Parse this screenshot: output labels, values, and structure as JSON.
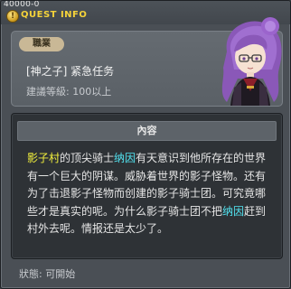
{
  "window": {
    "top_id": "40000-0",
    "title": "QUEST INFO"
  },
  "quest": {
    "job_label": "職業",
    "name": "[神之子] 紧急任务",
    "level": "建議等級: 100以上"
  },
  "description": {
    "header": "內容",
    "segments": [
      {
        "text": "影子村",
        "style": "yellow"
      },
      {
        "text": "的顶尖骑士",
        "style": "normal"
      },
      {
        "text": "纳因",
        "style": "cyan"
      },
      {
        "text": "有天意识到他所存在的世界有一个巨大的阴谋。威胁着世界的影子怪物。还有为了击退影子怪物而创建的影子骑士团。可究竟哪些才是真实的呢。为什么影子骑士团不把",
        "style": "normal"
      },
      {
        "text": "纳因",
        "style": "cyan"
      },
      {
        "text": "赶到村外去呢。情报还是太少了。",
        "style": "normal"
      }
    ]
  },
  "status": {
    "text": "狀態: 可開始"
  },
  "colors": {
    "title": "#f5d33a",
    "highlight_place": "#f2f03c",
    "highlight_npc": "#52e3f0"
  }
}
